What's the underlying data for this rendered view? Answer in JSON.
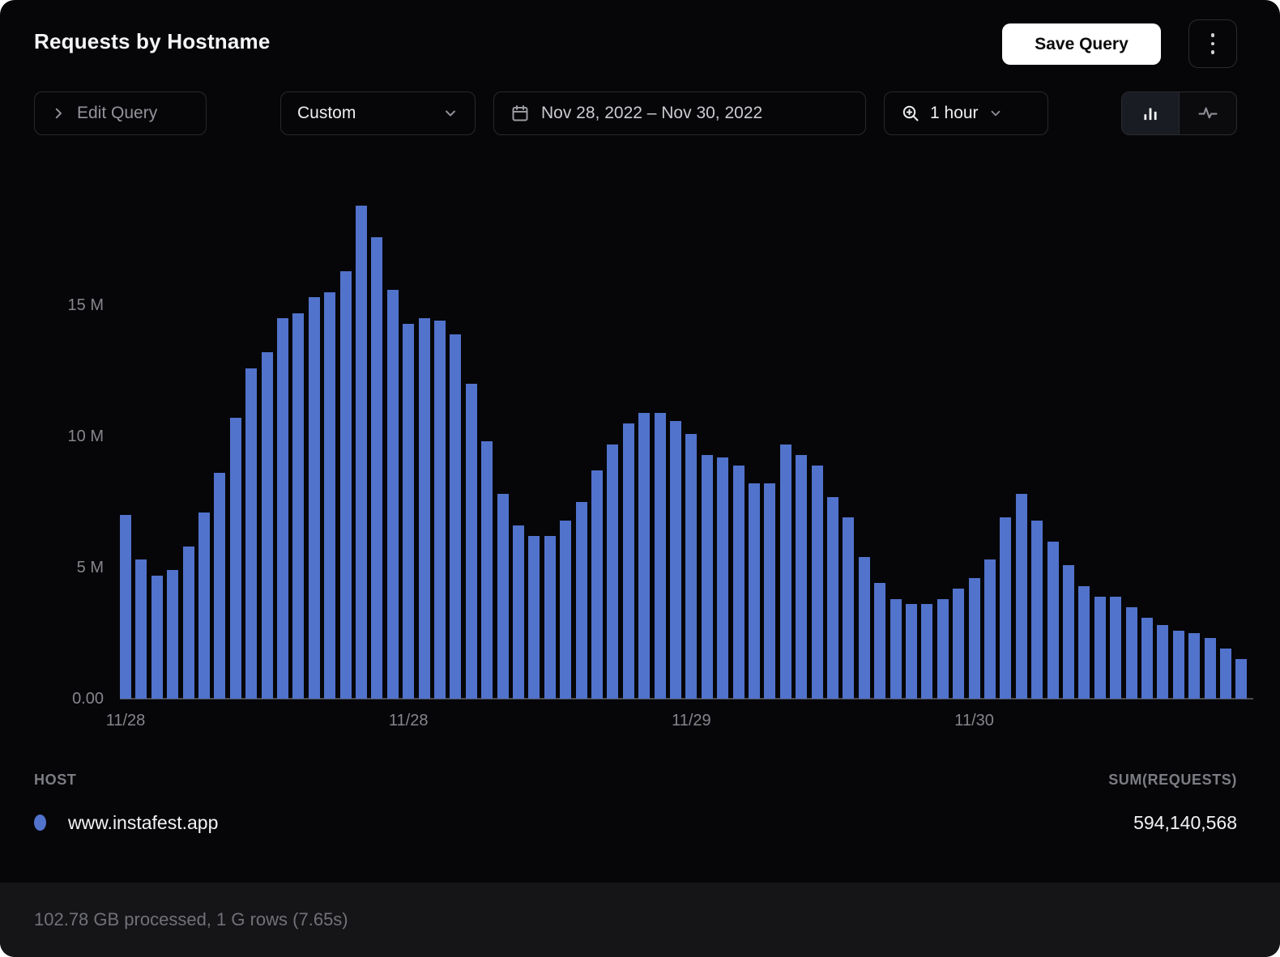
{
  "header": {
    "title": "Requests by Hostname",
    "save_button": "Save Query"
  },
  "toolbar": {
    "edit_query": "Edit Query",
    "range_preset": "Custom",
    "date_range": "Nov 28, 2022 – Nov 30, 2022",
    "interval": "1 hour"
  },
  "chart_data": {
    "type": "bar",
    "title": "Requests by Hostname",
    "unit": "requests per hour",
    "bar_color": "#5173cc",
    "axis_label_color": "#85868c",
    "ylim_millions": [
      0,
      19
    ],
    "grid": false,
    "y_ticks": [
      {
        "label": "15 M",
        "value_m": 15
      },
      {
        "label": "10 M",
        "value_m": 10
      },
      {
        "label": "5 M",
        "value_m": 5
      },
      {
        "label": "0.00",
        "value_m": 0
      }
    ],
    "x_ticks": [
      {
        "label": "11/28",
        "bar_index": 0
      },
      {
        "label": "11/28",
        "bar_index": 18
      },
      {
        "label": "11/29",
        "bar_index": 36
      },
      {
        "label": "11/30",
        "bar_index": 54
      }
    ],
    "series": [
      {
        "name": "www.instafest.app",
        "values_millions": [
          7.0,
          5.3,
          4.7,
          4.9,
          5.8,
          7.1,
          8.6,
          10.7,
          12.6,
          13.2,
          14.5,
          14.7,
          15.3,
          15.5,
          16.3,
          18.8,
          17.6,
          15.6,
          14.3,
          14.5,
          14.4,
          13.9,
          12.0,
          9.8,
          7.8,
          6.6,
          6.2,
          6.2,
          6.8,
          7.5,
          8.7,
          9.7,
          10.5,
          10.9,
          10.9,
          10.6,
          10.1,
          9.3,
          9.2,
          8.9,
          8.2,
          8.2,
          9.7,
          9.3,
          8.9,
          7.7,
          6.9,
          5.4,
          4.4,
          3.8,
          3.6,
          3.6,
          3.8,
          4.2,
          4.6,
          5.3,
          6.9,
          7.8,
          6.8,
          6.0,
          5.1,
          4.3,
          3.9,
          3.9,
          3.5,
          3.1,
          2.8,
          2.6,
          2.5,
          2.3,
          1.9,
          1.5
        ]
      }
    ]
  },
  "legend": {
    "host_header": "HOST",
    "sum_header": "SUM(REQUESTS)",
    "rows": [
      {
        "host": "www.instafest.app",
        "sum": "594,140,568",
        "color": "#5173cc"
      }
    ]
  },
  "footer": {
    "status": "102.78 GB processed, 1 G rows (7.65s)"
  }
}
